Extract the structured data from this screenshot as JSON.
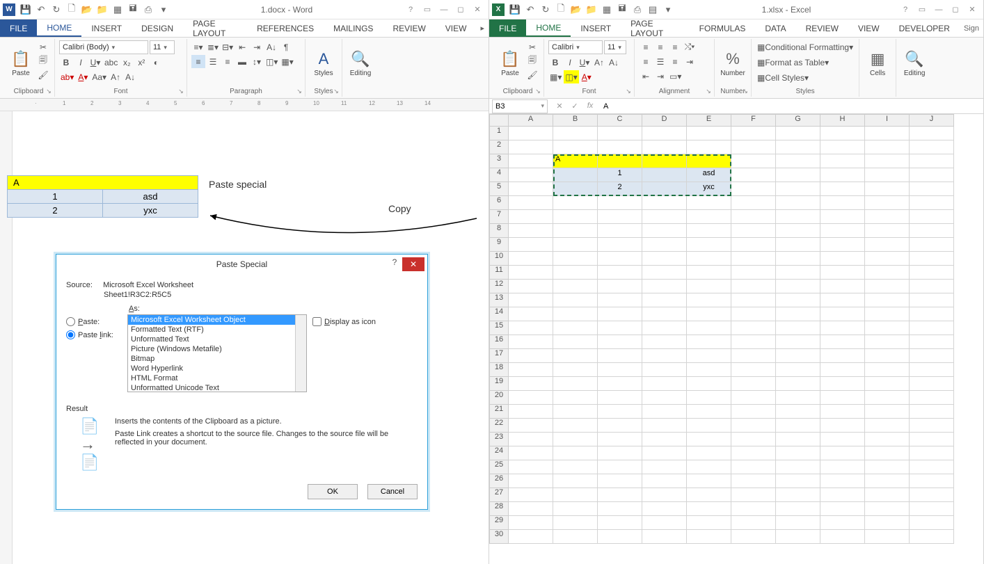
{
  "word": {
    "title": "1.docx - Word",
    "tabs": {
      "file": "FILE",
      "home": "HOME",
      "insert": "INSERT",
      "design": "DESIGN",
      "layout": "PAGE LAYOUT",
      "references": "REFERENCES",
      "mailings": "MAILINGS",
      "review": "REVIEW",
      "view": "VIEW"
    },
    "ribbon": {
      "clipboard": {
        "label": "Clipboard",
        "paste": "Paste"
      },
      "font": {
        "label": "Font",
        "name": "Calibri (Body)",
        "size": "11"
      },
      "paragraph": {
        "label": "Paragraph"
      },
      "styles": {
        "label": "Styles",
        "btn": "Styles"
      },
      "editing": {
        "label": "Editing"
      }
    },
    "table": {
      "header": "A",
      "rows": [
        [
          "1",
          "asd"
        ],
        [
          "2",
          "yxc"
        ]
      ]
    },
    "annot_paste": "Paste special",
    "annot_copy": "Copy"
  },
  "excel": {
    "title": "1.xlsx - Excel",
    "tabs": {
      "file": "FILE",
      "home": "HOME",
      "insert": "INSERT",
      "layout": "PAGE LAYOUT",
      "formulas": "FORMULAS",
      "data": "DATA",
      "review": "REVIEW",
      "view": "VIEW",
      "developer": "DEVELOPER",
      "sign": "Sign"
    },
    "ribbon": {
      "clipboard": "Clipboard",
      "paste": "Paste",
      "font_name": "Calibri",
      "font_size": "11",
      "font": "Font",
      "alignment": "Alignment",
      "number": "Number",
      "number_btn": "Number",
      "cond": "Conditional Formatting",
      "table": "Format as Table",
      "cellstyles": "Cell Styles",
      "styles": "Styles",
      "cells": "Cells",
      "editing": "Editing"
    },
    "namebox": "B3",
    "formula": "A",
    "cols": [
      "A",
      "B",
      "C",
      "D",
      "E",
      "F",
      "G",
      "H",
      "I",
      "J"
    ],
    "data": {
      "B3": "A",
      "C4": "1",
      "E4": "asd",
      "C5": "2",
      "E5": "yxc"
    }
  },
  "dialog": {
    "title": "Paste Special",
    "source_label": "Source:",
    "source_val": "Microsoft Excel Worksheet",
    "source_ref": "Sheet1!R3C2:R5C5",
    "as": "As:",
    "paste": "Paste:",
    "paste_link": "Paste link:",
    "display_icon": "Display as icon",
    "options": [
      "Microsoft Excel Worksheet Object",
      "Formatted Text (RTF)",
      "Unformatted Text",
      "Picture (Windows Metafile)",
      "Bitmap",
      "Word Hyperlink",
      "HTML Format",
      "Unformatted Unicode Text"
    ],
    "result": "Result",
    "result_text1": "Inserts the contents of the Clipboard as a picture.",
    "result_text2": "Paste Link creates a shortcut to the source file. Changes to the source file will be reflected in your document.",
    "ok": "OK",
    "cancel": "Cancel"
  }
}
